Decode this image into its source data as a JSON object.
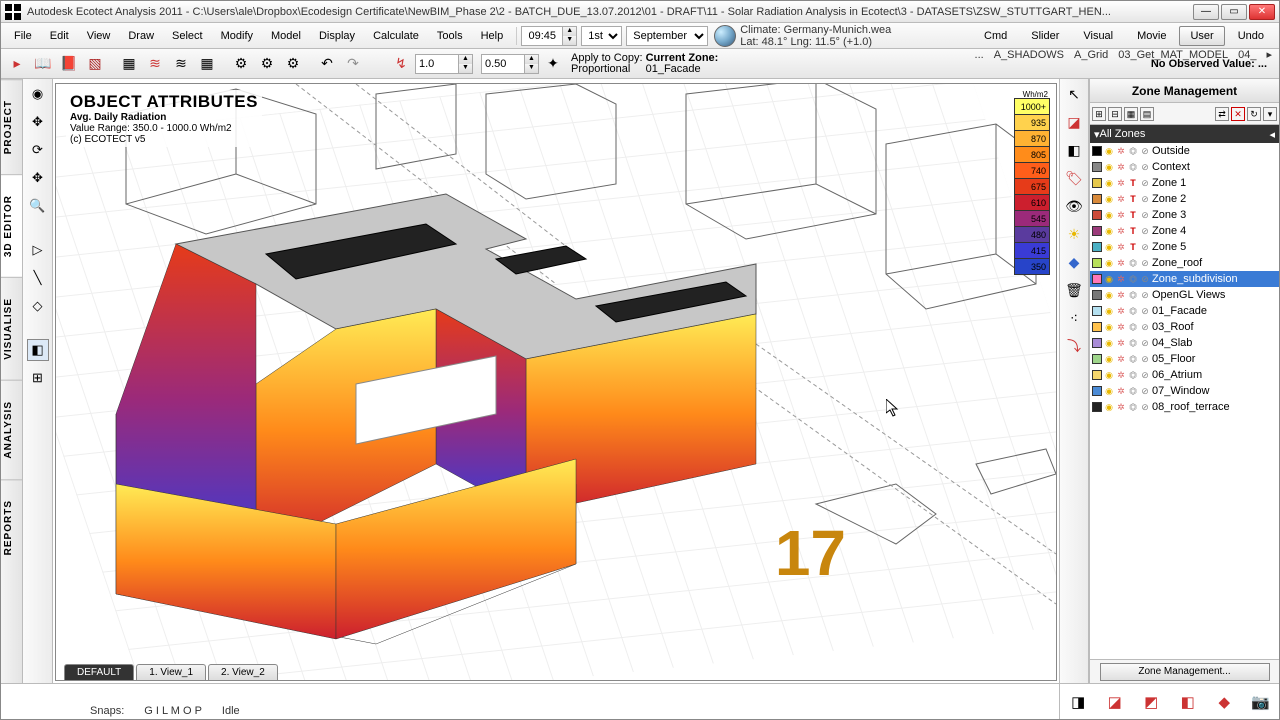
{
  "window": {
    "title": "Autodesk Ecotect Analysis 2011 - C:\\Users\\ale\\Dropbox\\Ecodesign Certificate\\NewBIM_Phase 2\\2 - BATCH_DUE_13.07.2012\\01 - DRAFT\\11 - Solar Radiation Analysis in Ecotect\\3 - DATASETS\\ZSW_STUTTGART_HEN..."
  },
  "menu": [
    "File",
    "Edit",
    "View",
    "Draw",
    "Select",
    "Modify",
    "Model",
    "Display",
    "Calculate",
    "Tools",
    "Help"
  ],
  "time": {
    "value": "09:45",
    "day": "1st",
    "month": "September"
  },
  "climate": {
    "file": "Climate: Germany-Munich.wea",
    "coords": "Lat: 48.1°   Lng: 11.5° (+1.0)"
  },
  "rightTabs": [
    "Cmd",
    "Slider",
    "Visual",
    "Movie",
    "User",
    "Undo"
  ],
  "rightTabActive": "User",
  "scriptTabs": [
    "...",
    "A_SHADOWS",
    "A_Grid",
    "03_Get_MAT_MODEL",
    "04_"
  ],
  "observed": "No Observed Value:  ...",
  "tool2": {
    "a": "1.0",
    "b": "0.50",
    "apply": "Apply to Copy:",
    "prop": "Proportional",
    "cz": "Current Zone:",
    "czv": "01_Facade"
  },
  "overlay": {
    "title": "OBJECT ATTRIBUTES",
    "sub": "Avg. Daily Radiation",
    "range": "Value Range: 350.0 - 1000.0 Wh/m2",
    "credit": "(c) ECOTECT v5"
  },
  "legendUnit": "Wh/m2",
  "legend": [
    {
      "v": "1000+",
      "c": "#ffff66"
    },
    {
      "v": "935",
      "c": "#ffd24d"
    },
    {
      "v": "870",
      "c": "#ffb233"
    },
    {
      "v": "805",
      "c": "#ff8c1a"
    },
    {
      "v": "740",
      "c": "#ff5e1a"
    },
    {
      "v": "675",
      "c": "#e63b19"
    },
    {
      "v": "610",
      "c": "#cc1f2e"
    },
    {
      "v": "545",
      "c": "#9b2a7a"
    },
    {
      "v": "480",
      "c": "#5a3b9e"
    },
    {
      "v": "415",
      "c": "#3a3bd5"
    },
    {
      "v": "350",
      "c": "#2744c9"
    }
  ],
  "viewTabs": [
    "DEFAULT",
    "1. View_1",
    "2. View_2"
  ],
  "bigNum": "17",
  "panel": {
    "title": "Zone Management",
    "all": "All Zones",
    "foot": "Zone Management..."
  },
  "zones": [
    {
      "name": "Outside",
      "c": "#000",
      "thermal": false
    },
    {
      "name": "Context",
      "c": "#888",
      "thermal": false
    },
    {
      "name": "Zone 1",
      "c": "#e6c84b",
      "thermal": true
    },
    {
      "name": "Zone 2",
      "c": "#d98a3a",
      "thermal": true
    },
    {
      "name": "Zone 3",
      "c": "#cc4b3a",
      "thermal": true
    },
    {
      "name": "Zone 4",
      "c": "#9b3a7a",
      "thermal": true
    },
    {
      "name": "Zone 5",
      "c": "#4bb0c4",
      "thermal": true
    },
    {
      "name": "Zone_roof",
      "c": "#b8e05a",
      "thermal": false
    },
    {
      "name": "Zone_subdivision",
      "c": "#ff77b8",
      "thermal": false,
      "sel": true
    },
    {
      "name": "OpenGL Views",
      "c": "#777",
      "thermal": false
    },
    {
      "name": "01_Facade",
      "c": "#b4e0f0",
      "thermal": false
    },
    {
      "name": "03_Roof",
      "c": "#ffc24d",
      "thermal": false
    },
    {
      "name": "04_Slab",
      "c": "#a88bd6",
      "thermal": false
    },
    {
      "name": "05_Floor",
      "c": "#9fd68b",
      "thermal": false
    },
    {
      "name": "06_Atrium",
      "c": "#f5d76e",
      "thermal": false
    },
    {
      "name": "07_Window",
      "c": "#4b8bd6",
      "thermal": false
    },
    {
      "name": "08_roof_terrace",
      "c": "#222",
      "thermal": false
    }
  ],
  "status": {
    "snaps": "Snaps:",
    "letters": "G I  L  M O P",
    "idle": "Idle"
  },
  "vtabs": [
    "PROJECT",
    "3D EDITOR",
    "VISUALISE",
    "ANALYSIS",
    "REPORTS"
  ]
}
